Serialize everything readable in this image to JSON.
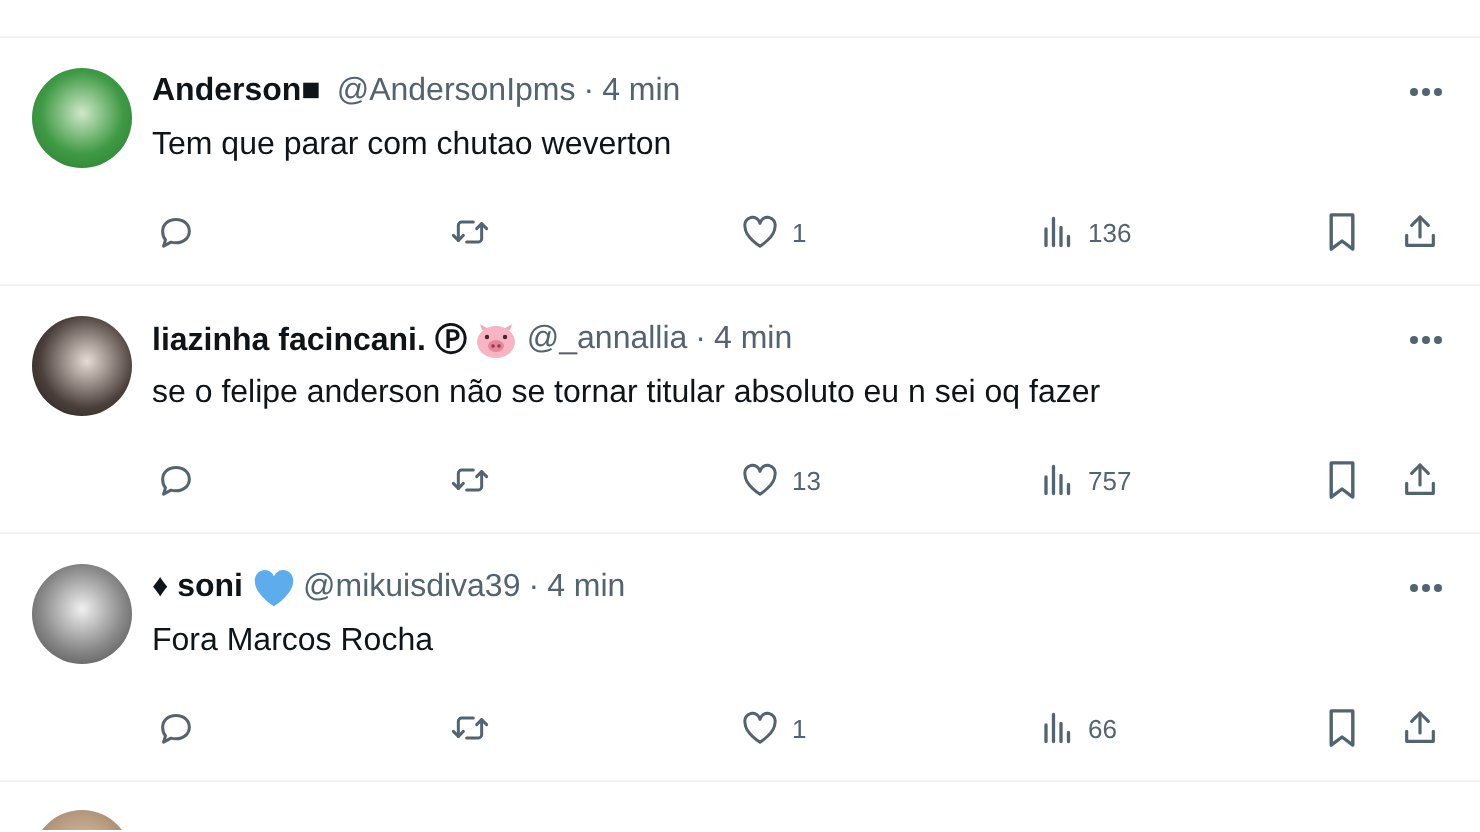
{
  "tweets": [
    {
      "name": "Anderson■",
      "handle": "@AndersonIpms",
      "separator": "·",
      "time": "4 min",
      "text": "Tem que parar com chutao weverton",
      "likes": "1",
      "views": "136"
    },
    {
      "name": "liazinha facincani. Ⓟ",
      "badges": [
        {
          "kind": "pig"
        }
      ],
      "handle": "@_annallia",
      "separator": "·",
      "time": "4 min",
      "text": "se o felipe anderson não se tornar titular absoluto eu n sei oq fazer",
      "likes": "13",
      "views": "757"
    },
    {
      "name": "♦ soni",
      "badges": [
        {
          "kind": "heart"
        }
      ],
      "handle": "@mikuisdiva39",
      "separator": "·",
      "time": "4 min",
      "text": "Fora Marcos Rocha",
      "likes": "1",
      "views": "66"
    }
  ]
}
